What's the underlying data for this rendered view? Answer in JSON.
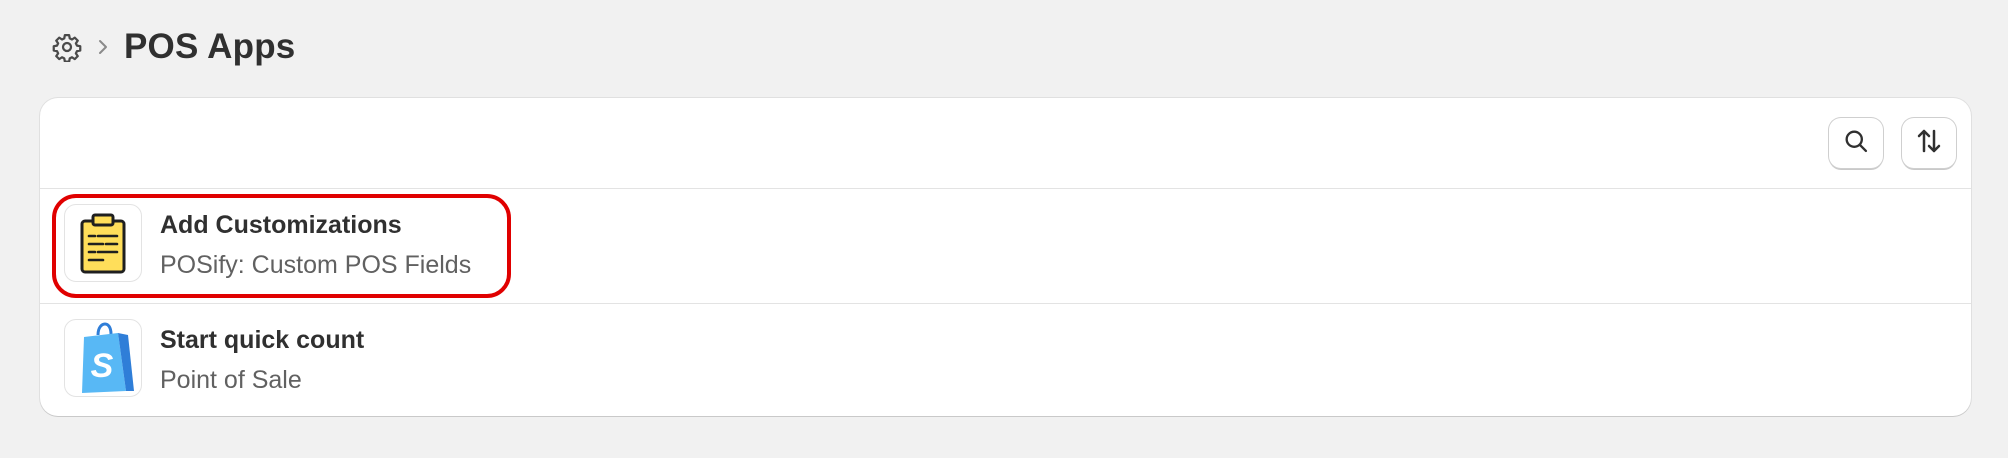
{
  "breadcrumb": {
    "settings_icon": "gear-icon",
    "separator_icon": "chevron-right-icon",
    "title": "POS Apps"
  },
  "toolbar": {
    "search_icon": "search-icon",
    "sort_icon": "sort-arrows-icon"
  },
  "apps": [
    {
      "title": "Add Customizations",
      "subtitle": "POSify: Custom POS Fields",
      "icon": "clipboard-icon",
      "highlighted": true
    },
    {
      "title": "Start quick count",
      "subtitle": "Point of Sale",
      "icon": "shopify-bag-icon",
      "highlighted": false
    }
  ],
  "colors": {
    "highlight": "#e00000",
    "clipboard_fill": "#ffde5a",
    "shopify_light": "#58b8f5",
    "shopify_dark": "#2f7ed8"
  }
}
